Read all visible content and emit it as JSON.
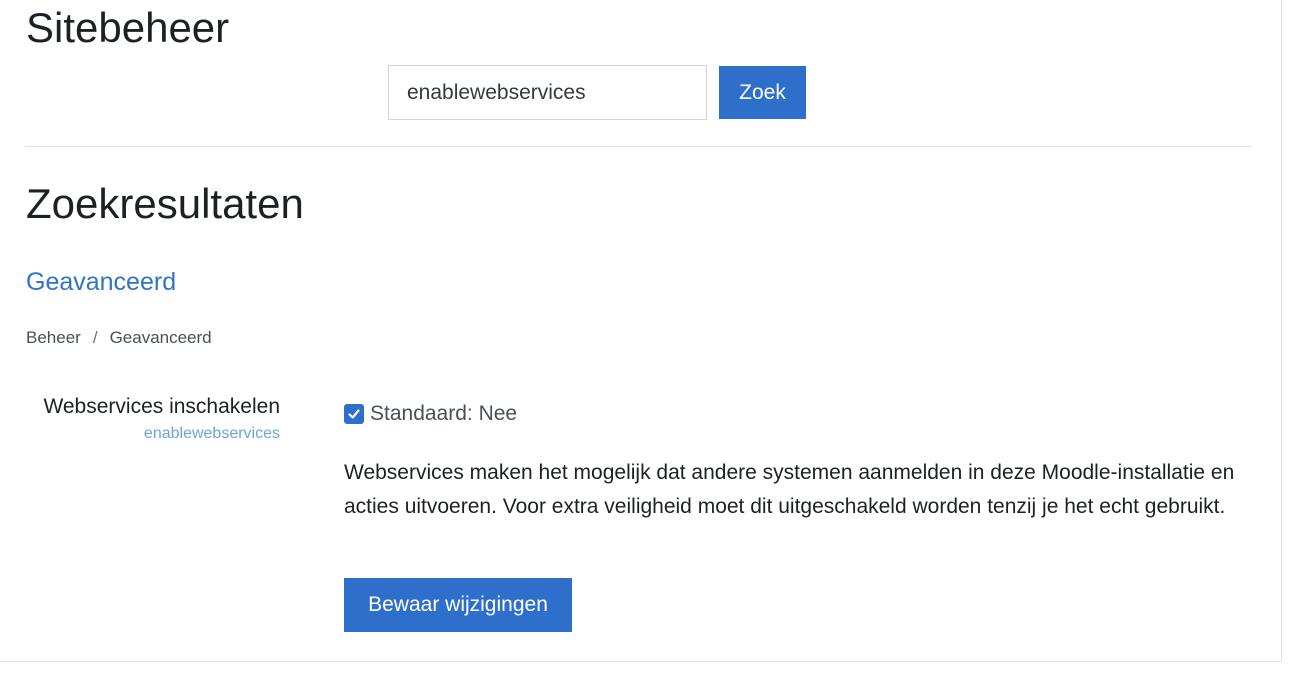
{
  "page": {
    "title": "Sitebeheer"
  },
  "search": {
    "value": "enablewebservices",
    "button_label": "Zoek"
  },
  "results": {
    "title": "Zoekresultaten",
    "section_link": "Geavanceerd",
    "breadcrumb": {
      "items": [
        "Beheer",
        "Geavanceerd"
      ],
      "separator": "/"
    },
    "setting": {
      "name": "Webservices inschakelen",
      "key": "enablewebservices",
      "checked": true,
      "default_text": "Standaard: Nee",
      "description": "Webservices maken het mogelijk dat andere systemen aanmelden in deze Moodle-installatie en acties uitvoeren. Voor extra veiligheid moet dit uitgeschakeld worden tenzij je het echt gebruikt."
    },
    "save_label": "Bewaar wijzigingen"
  },
  "colors": {
    "primary": "#2d6fcb",
    "link": "#2f74c8",
    "setting_key": "#6aa7d0"
  },
  "icons": {
    "checkbox": "checkmark-icon"
  }
}
